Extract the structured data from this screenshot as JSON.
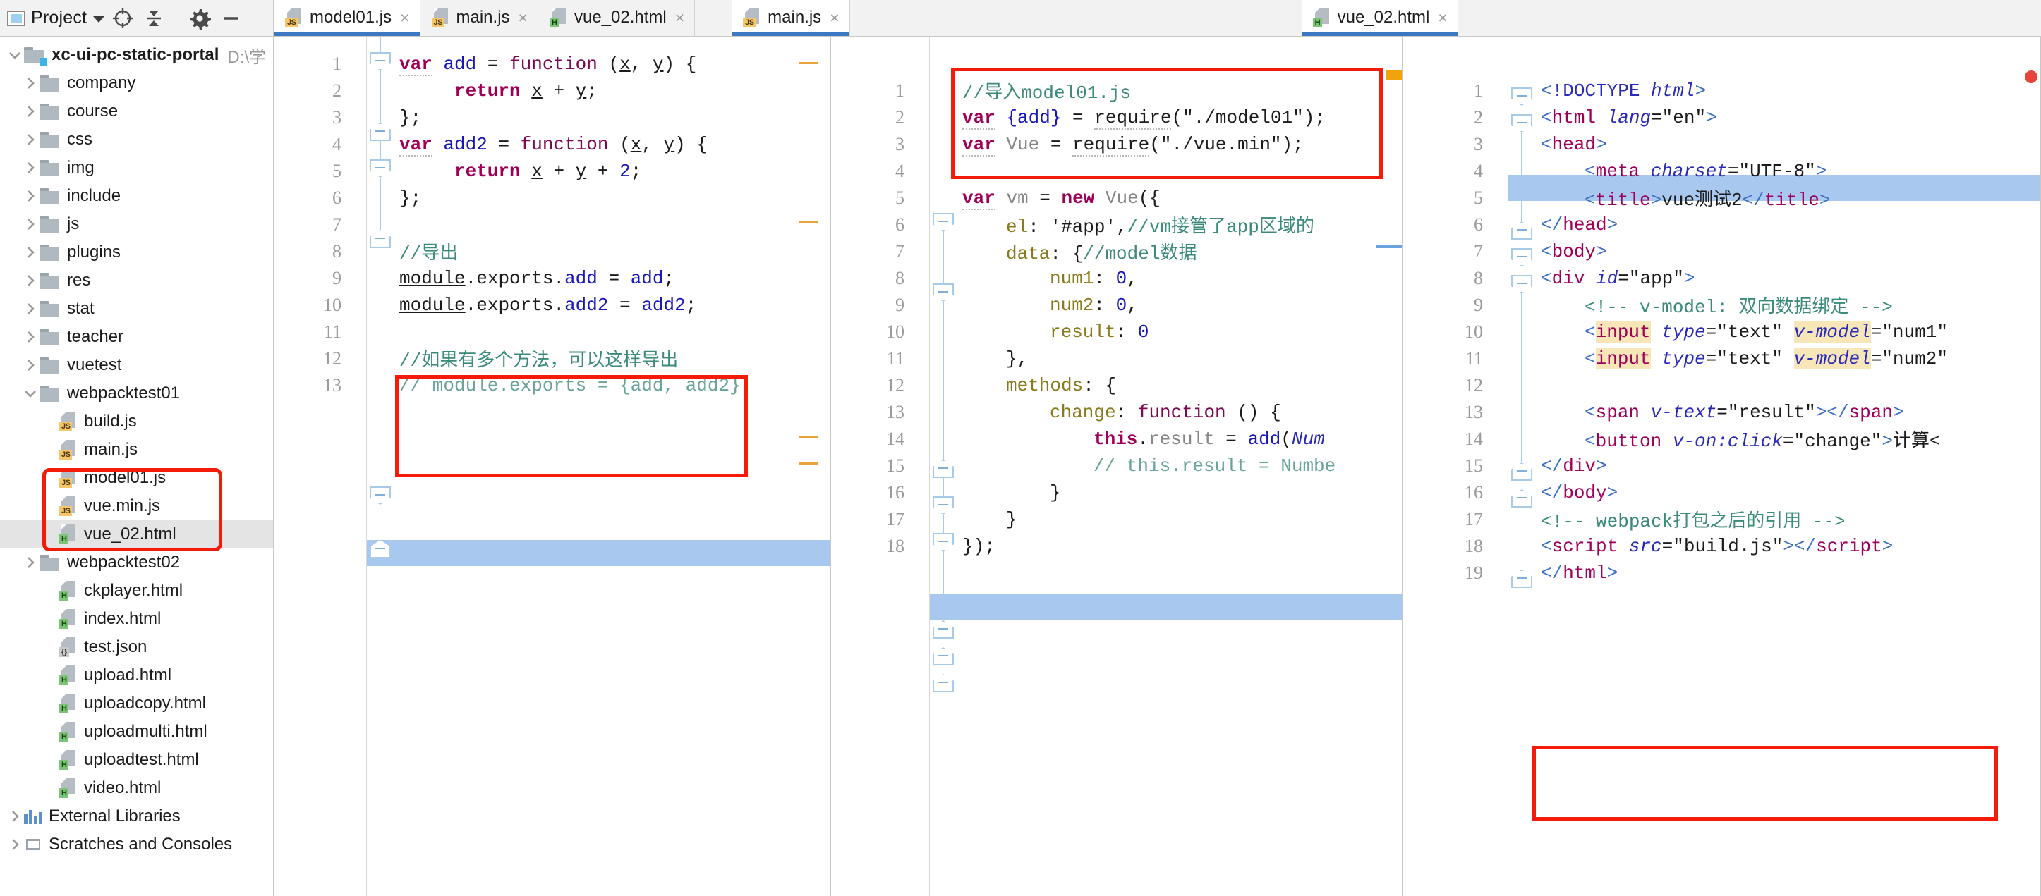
{
  "toolbar": {
    "project_label": "Project",
    "icons": [
      "project-window-icon",
      "chevron-down-icon",
      "locate-icon",
      "collapse-all-icon",
      "gear-icon",
      "minimize-icon"
    ]
  },
  "tabs": {
    "group1": [
      {
        "name": "model01.js",
        "type": "js",
        "selected": true,
        "close": "×"
      },
      {
        "name": "main.js",
        "type": "js",
        "selected": false,
        "close": "×"
      },
      {
        "name": "vue_02.html",
        "type": "html",
        "selected": false,
        "close": "×"
      }
    ],
    "group2": [
      {
        "name": "main.js",
        "type": "js",
        "selected": true,
        "close": "×"
      }
    ],
    "group3": [
      {
        "name": "vue_02.html",
        "type": "html",
        "selected": true,
        "close": "×"
      }
    ]
  },
  "sidebar": {
    "items": [
      {
        "label": "xc-ui-pc-static-portal",
        "path": "D:\\学",
        "kind": "root",
        "indent": 0,
        "arrow": "down",
        "bold": true
      },
      {
        "label": "company",
        "kind": "folder",
        "indent": 1,
        "arrow": "right"
      },
      {
        "label": "course",
        "kind": "folder",
        "indent": 1,
        "arrow": "right"
      },
      {
        "label": "css",
        "kind": "folder",
        "indent": 1,
        "arrow": "right"
      },
      {
        "label": "img",
        "kind": "folder",
        "indent": 1,
        "arrow": "right"
      },
      {
        "label": "include",
        "kind": "folder",
        "indent": 1,
        "arrow": "right"
      },
      {
        "label": "js",
        "kind": "folder",
        "indent": 1,
        "arrow": "right"
      },
      {
        "label": "plugins",
        "kind": "folder",
        "indent": 1,
        "arrow": "right"
      },
      {
        "label": "res",
        "kind": "folder",
        "indent": 1,
        "arrow": "right"
      },
      {
        "label": "stat",
        "kind": "folder",
        "indent": 1,
        "arrow": "right"
      },
      {
        "label": "teacher",
        "kind": "folder",
        "indent": 1,
        "arrow": "right"
      },
      {
        "label": "vuetest",
        "kind": "folder",
        "indent": 1,
        "arrow": "right"
      },
      {
        "label": "webpacktest01",
        "kind": "folder",
        "indent": 1,
        "arrow": "down"
      },
      {
        "label": "build.js",
        "kind": "js",
        "indent": 2,
        "arrow": "none"
      },
      {
        "label": "main.js",
        "kind": "js",
        "indent": 2,
        "arrow": "none"
      },
      {
        "label": "model01.js",
        "kind": "js",
        "indent": 2,
        "arrow": "none"
      },
      {
        "label": "vue.min.js",
        "kind": "js",
        "indent": 2,
        "arrow": "none"
      },
      {
        "label": "vue_02.html",
        "kind": "html",
        "indent": 2,
        "arrow": "none",
        "selected": true
      },
      {
        "label": "webpacktest02",
        "kind": "folder",
        "indent": 1,
        "arrow": "right"
      },
      {
        "label": "ckplayer.html",
        "kind": "html",
        "indent": 2,
        "arrow": "none"
      },
      {
        "label": "index.html",
        "kind": "html",
        "indent": 2,
        "arrow": "none"
      },
      {
        "label": "test.json",
        "kind": "json",
        "indent": 2,
        "arrow": "none"
      },
      {
        "label": "upload.html",
        "kind": "html",
        "indent": 2,
        "arrow": "none"
      },
      {
        "label": "uploadcopy.html",
        "kind": "html",
        "indent": 2,
        "arrow": "none"
      },
      {
        "label": "uploadmulti.html",
        "kind": "html",
        "indent": 2,
        "arrow": "none"
      },
      {
        "label": "uploadtest.html",
        "kind": "html",
        "indent": 2,
        "arrow": "none"
      },
      {
        "label": "video.html",
        "kind": "html",
        "indent": 2,
        "arrow": "none"
      },
      {
        "label": "External Libraries",
        "kind": "libs",
        "indent": 0,
        "arrow": "right"
      },
      {
        "label": "Scratches and Consoles",
        "kind": "scratch",
        "indent": 0,
        "arrow": "right"
      }
    ]
  },
  "editor1": {
    "file": "model01.js",
    "line_numbers": [
      "1",
      "2",
      "3",
      "4",
      "5",
      "6",
      "7",
      "8",
      "9",
      "10",
      "11",
      "12",
      "13"
    ],
    "highlight_line": 13,
    "annotation_label": "red-box-around-module-exports",
    "lines": [
      "var add = function (x, y) {",
      "    return x + y;",
      "};",
      "var add2 = function (x, y) {",
      "    return x + y + 2;",
      "};",
      "",
      "//导出",
      "module.exports.add = add;",
      "module.exports.add2 = add2;",
      "",
      "//如果有多个方法，可以这样导出",
      "// module.exports = {add, add2};"
    ]
  },
  "editor2": {
    "file": "main.js",
    "line_numbers": [
      "1",
      "2",
      "3",
      "4",
      "5",
      "6",
      "7",
      "8",
      "9",
      "10",
      "11",
      "12",
      "13",
      "14",
      "15",
      "16",
      "17",
      "18"
    ],
    "highlight_line": 14,
    "annotation_label": "red-box-around-require-imports",
    "lines": [
      "//导入model01.js",
      "var {add} = require(\"./model01\");",
      "var Vue = require(\"./vue.min\");",
      "",
      "var vm = new Vue({",
      "    el: '#app',//vm接管了app区域的",
      "    data: {//model数据",
      "        num1: 0,",
      "        num2: 0,",
      "        result: 0",
      "    },",
      "    methods: {",
      "        change: function () {",
      "            this.result = add(Num",
      "            // this.result = Numbe",
      "        }",
      "    }",
      "});"
    ]
  },
  "editor3": {
    "file": "vue_02.html",
    "line_numbers": [
      "1",
      "2",
      "3",
      "4",
      "5",
      "6",
      "7",
      "8",
      "9",
      "10",
      "11",
      "12",
      "13",
      "14",
      "15",
      "16",
      "17",
      "18",
      "19"
    ],
    "highlight_line": 4,
    "annotation_label": "red-box-around-build-js-script",
    "lines": [
      "<!DOCTYPE html>",
      "<html lang=\"en\">",
      "<head>",
      "    <meta charset=\"UTF-8\">",
      "    <title>vue测试2</title>",
      "</head>",
      "<body>",
      "<div id=\"app\">",
      "    <!-- v-model: 双向数据绑定 -->",
      "    <input type=\"text\" v-model=\"num1\"",
      "    <input type=\"text\" v-model=\"num2\"",
      "",
      "    <span v-text=\"result\"></span>",
      "    <button v-on:click=\"change\">计算<",
      "</div>",
      "</body>",
      "<!-- webpack打包之后的引用 -->",
      "<script src=\"build.js\"></script>",
      "</html>"
    ]
  },
  "colors": {
    "accent_blue": "#3c77c2",
    "annotation_red": "#f41b09",
    "selection_blue": "#a8c8f0",
    "keyword": "#9e0059",
    "comment": "#3c8a7a",
    "highlight_yellow": "#f7e6b8",
    "marker_orange": "#f0a30a",
    "marker_red": "#e8443a"
  }
}
